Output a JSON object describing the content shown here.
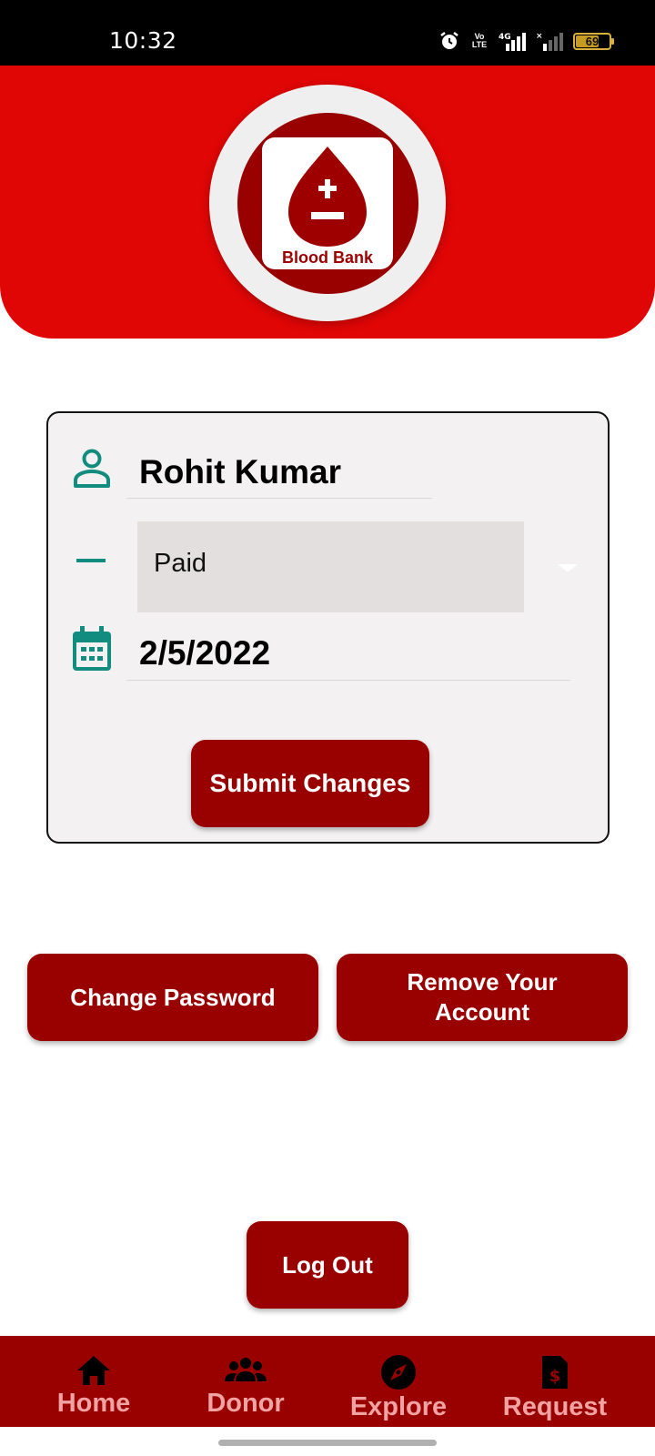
{
  "status_bar": {
    "time": "10:32",
    "volte_label_top": "Vo",
    "volte_label_bottom": "LTE",
    "network": "4G",
    "battery": "69"
  },
  "header": {
    "logo_text": "Blood Bank",
    "colors": {
      "header": "#e00606",
      "dark_red": "#990000"
    }
  },
  "profile_form": {
    "name": "Rohit Kumar",
    "blood_status_selected": "Paid",
    "date": "2/5/2022",
    "submit_label": "Submit Changes",
    "icons": {
      "name": "person-icon",
      "status": "minus-icon",
      "date": "calendar-icon"
    },
    "icon_color": "#128c7e"
  },
  "actions": {
    "change_password_label": "Change Password",
    "remove_account_label": "Remove Your Account",
    "logout_label": "Log Out"
  },
  "bottom_nav": {
    "items": [
      {
        "label": "Home",
        "icon": "home-icon"
      },
      {
        "label": "Donor",
        "icon": "people-icon"
      },
      {
        "label": "Explore",
        "icon": "compass-icon"
      },
      {
        "label": "Request",
        "icon": "receipt-icon"
      }
    ],
    "label_color": "#f1a3a3"
  }
}
